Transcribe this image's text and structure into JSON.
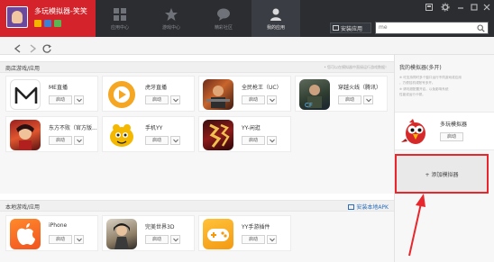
{
  "app": {
    "title": "多玩模拟器-笑笑"
  },
  "nav": {
    "tabs": [
      {
        "label": "应用中心",
        "active": false
      },
      {
        "label": "游戏中心",
        "active": false
      },
      {
        "label": "精彩社区",
        "active": false
      },
      {
        "label": "我的应用",
        "active": true
      }
    ],
    "install_label": "安装应用",
    "search_value": "me"
  },
  "store_section": {
    "title": "商店游戏/应用",
    "hint": "• 您可以在模拟器中直接运行游戏数据！",
    "start_label": "启动",
    "apps": [
      {
        "name": "ME直播",
        "icon": "me-live-icon"
      },
      {
        "name": "虎牙直播",
        "icon": "huya-live-icon"
      },
      {
        "name": "全民枪王（UC）",
        "icon": "gun-king-icon"
      },
      {
        "name": "穿越火线（腾讯）",
        "icon": "crossfire-icon"
      },
      {
        "name": "东方不败（官方版...",
        "icon": "dongfang-bubai-icon"
      },
      {
        "name": "手机YY",
        "icon": "mobile-yy-icon"
      },
      {
        "name": "YY-闲逛",
        "icon": "yy-xianguang-icon"
      }
    ]
  },
  "local_section": {
    "title": "本地游戏/应用",
    "apk_label": "安装本地APK",
    "start_label": "启动",
    "apps": [
      {
        "name": "iPhone",
        "icon": "iphone-app-icon"
      },
      {
        "name": "完美世界3D",
        "icon": "perfect-world-icon"
      },
      {
        "name": "YY手游插件",
        "icon": "yy-game-plugin-icon"
      }
    ]
  },
  "emulator_panel": {
    "title": "我的模拟器(多开)",
    "notes": [
      "※ 可支持同时多个窗口运行不同游戏或应用",
      "  ，方便挂机或账号多开。",
      "※ 请勿超配置开启，以免影响系统",
      "  性能或运行卡顿。"
    ],
    "emulator_name": "多玩模拟器",
    "start_label": "启动",
    "add_label": "+ 添加模拟器"
  },
  "colors": {
    "brand_red": "#d4232b",
    "highlight_red": "#e8262b",
    "titlebar": "#2b2d31",
    "link_blue": "#2a6ebb"
  }
}
